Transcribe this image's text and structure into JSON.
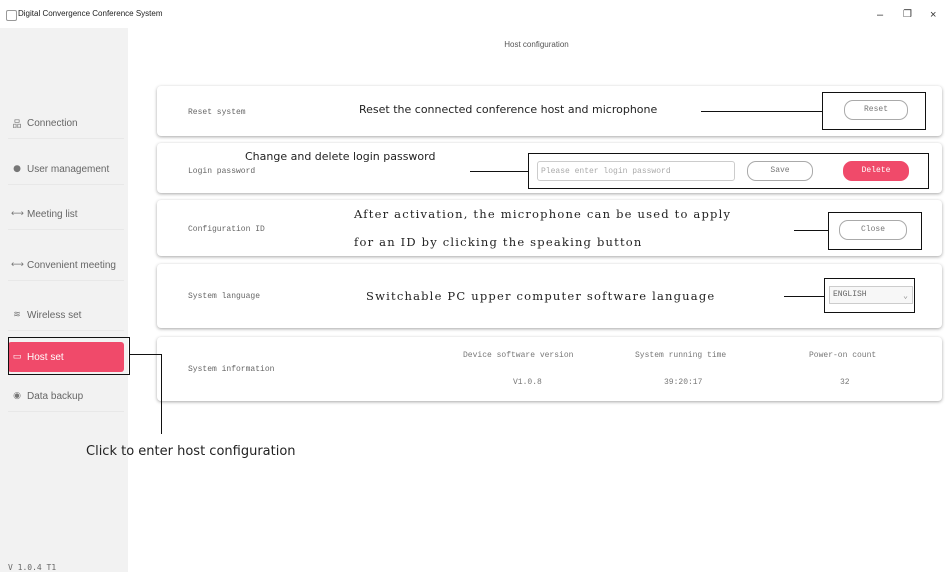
{
  "window": {
    "title": "Digital Convergence Conference System",
    "min_glyph": "–",
    "max_glyph": "❐",
    "close_glyph": "×"
  },
  "sidebar": {
    "items": [
      {
        "label": "Connection",
        "icon": "connection-icon",
        "glyph": "品"
      },
      {
        "label": "User management",
        "icon": "user-icon",
        "glyph": "●"
      },
      {
        "label": "Meeting list",
        "icon": "meeting-list-icon",
        "glyph": "⟷"
      },
      {
        "label": "Convenient meeting",
        "icon": "convenient-meeting-icon",
        "glyph": "⟷"
      },
      {
        "label": "Wireless set",
        "icon": "wifi-icon",
        "glyph": "≋"
      },
      {
        "label": "Host set",
        "icon": "host-icon",
        "glyph": "▭",
        "active": true
      },
      {
        "label": "Data backup",
        "icon": "backup-icon",
        "glyph": "◉"
      }
    ],
    "version": "V 1.0.4 T1"
  },
  "main": {
    "title": "Host configuration",
    "reset": {
      "label": "Reset system",
      "button": "Reset"
    },
    "login": {
      "label": "Login password",
      "placeholder": "Please enter login password",
      "save": "Save",
      "delete": "Delete"
    },
    "config": {
      "label": "Configuration ID",
      "button": "Close"
    },
    "language": {
      "label": "System language",
      "value": "ENGLISH"
    },
    "info": {
      "label": "System information",
      "headers": [
        "Device software version",
        "System running time",
        "Power-on count"
      ],
      "values": [
        "V1.0.8",
        "39:20:17",
        "32"
      ]
    }
  },
  "annotations": {
    "reset": "Reset the connected conference host and microphone",
    "login": "Change and delete login password",
    "config_line1": "After activation, the microphone can be used to apply",
    "config_line2": "for an ID by clicking the speaking button",
    "language": "Switchable PC upper computer software language",
    "host": "Click to enter host configuration"
  },
  "colors": {
    "accent": "#f04a6a",
    "sidebar_bg": "#f2f2f2"
  }
}
